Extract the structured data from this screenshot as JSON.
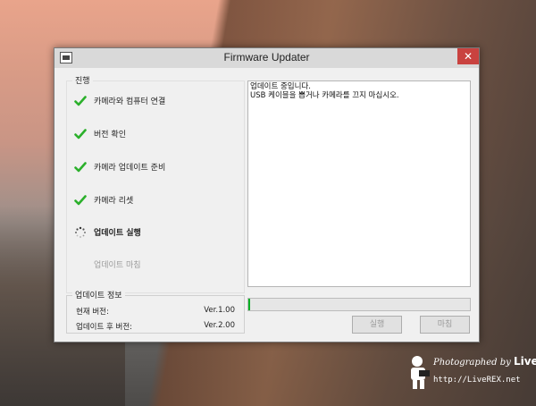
{
  "window": {
    "title": "Firmware Updater",
    "close_symbol": "✕"
  },
  "progress_group": {
    "label": "진행",
    "steps": [
      {
        "label": "카메라와 컴퓨터 연결",
        "status": "done",
        "icon": "check-icon"
      },
      {
        "label": "버전 확인",
        "status": "done",
        "icon": "check-icon"
      },
      {
        "label": "카메라 업데이트 준비",
        "status": "done",
        "icon": "check-icon"
      },
      {
        "label": "카메라 리셋",
        "status": "done",
        "icon": "check-icon"
      },
      {
        "label": "업데이트 실행",
        "status": "current",
        "icon": "spinner-icon"
      },
      {
        "label": "업데이트 마침",
        "status": "pending",
        "icon": ""
      }
    ]
  },
  "log": {
    "lines": [
      "업데이트 중입니다.",
      "USB 케이블을 뽑거나 카메라를 끄지 마십시오."
    ]
  },
  "update_info": {
    "label": "업데이트 정보",
    "current_version_label": "현재 버전:",
    "current_version": "Ver.1.00",
    "after_version_label": "업데이트 후 버전:",
    "after_version": "Ver.2.00"
  },
  "progress": {
    "percent": 1,
    "color": "#06b025"
  },
  "buttons": {
    "run_label": "실행",
    "finish_label": "마침"
  },
  "watermark": {
    "line1_prefix": "Photographed by",
    "brand": "LiveREX",
    "url": "http://LiveREX.net"
  }
}
